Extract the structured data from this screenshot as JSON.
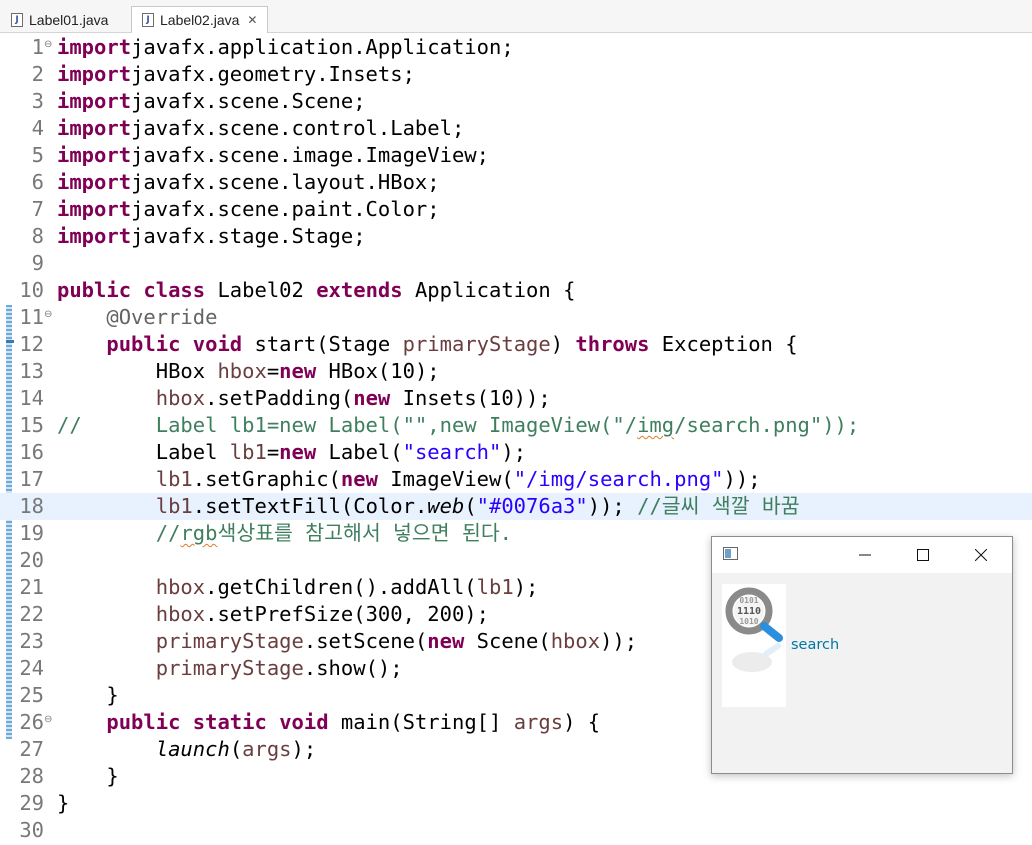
{
  "tabs": [
    {
      "label": "Label01.java",
      "icon": "java-file-icon",
      "active": false
    },
    {
      "label": "Label02.java",
      "icon": "java-file-icon",
      "active": true,
      "close_glyph": "✕"
    }
  ],
  "editor": {
    "current_line": 18,
    "lines": [
      {
        "n": "1",
        "fold": "⊖",
        "tokens": [
          [
            "kw",
            "import"
          ],
          [
            "",
            "javafx.application.Application;"
          ]
        ]
      },
      {
        "n": "2",
        "tokens": [
          [
            "kw",
            "import"
          ],
          [
            "",
            "javafx.geometry.Insets;"
          ]
        ]
      },
      {
        "n": "3",
        "tokens": [
          [
            "kw",
            "import"
          ],
          [
            "",
            "javafx.scene.Scene;"
          ]
        ]
      },
      {
        "n": "4",
        "tokens": [
          [
            "kw",
            "import"
          ],
          [
            "",
            "javafx.scene.control.Label;"
          ]
        ]
      },
      {
        "n": "5",
        "tokens": [
          [
            "kw",
            "import"
          ],
          [
            "",
            "javafx.scene.image.ImageView;"
          ]
        ]
      },
      {
        "n": "6",
        "tokens": [
          [
            "kw",
            "import"
          ],
          [
            "",
            "javafx.scene.layout.HBox;"
          ]
        ]
      },
      {
        "n": "7",
        "tokens": [
          [
            "kw",
            "import"
          ],
          [
            "",
            "javafx.scene.paint.Color;"
          ]
        ]
      },
      {
        "n": "8",
        "tokens": [
          [
            "kw",
            "import"
          ],
          [
            "",
            "javafx.stage.Stage;"
          ]
        ]
      },
      {
        "n": "9",
        "tokens": []
      },
      {
        "n": "10",
        "tokens": [
          [
            "kw",
            "public"
          ],
          [
            "",
            " "
          ],
          [
            "kw",
            "class"
          ],
          [
            "",
            " Label02 "
          ],
          [
            "kw",
            "extends"
          ],
          [
            "",
            " Application {"
          ]
        ]
      },
      {
        "n": "11",
        "fold": "⊖",
        "tokens": [
          [
            "",
            "    "
          ],
          [
            "ann",
            "@Override"
          ]
        ]
      },
      {
        "n": "12",
        "tokens": [
          [
            "",
            "    "
          ],
          [
            "kw",
            "public"
          ],
          [
            "",
            " "
          ],
          [
            "kw",
            "void"
          ],
          [
            "",
            " start(Stage "
          ],
          [
            "var",
            "primaryStage"
          ],
          [
            "",
            ") "
          ],
          [
            "kw",
            "throws"
          ],
          [
            "",
            " Exception {"
          ]
        ]
      },
      {
        "n": "13",
        "tokens": [
          [
            "",
            "        HBox "
          ],
          [
            "var",
            "hbox"
          ],
          [
            "",
            "="
          ],
          [
            "kw",
            "new"
          ],
          [
            "",
            " HBox(10);"
          ]
        ]
      },
      {
        "n": "14",
        "tokens": [
          [
            "",
            "        "
          ],
          [
            "var",
            "hbox"
          ],
          [
            "",
            ".setPadding("
          ],
          [
            "kw",
            "new"
          ],
          [
            "",
            " Insets(10));"
          ]
        ]
      },
      {
        "n": "15",
        "tokens": [
          [
            "cmt",
            "//      Label lb1=new Label(\"\",new ImageView(\"/"
          ],
          [
            "cmt spl",
            "img"
          ],
          [
            "cmt",
            "/search.png\"));"
          ]
        ]
      },
      {
        "n": "16",
        "tokens": [
          [
            "",
            "        Label "
          ],
          [
            "var",
            "lb1"
          ],
          [
            "",
            "="
          ],
          [
            "kw",
            "new"
          ],
          [
            "",
            " Label("
          ],
          [
            "str",
            "\"search\""
          ],
          [
            "",
            ");"
          ]
        ]
      },
      {
        "n": "17",
        "tokens": [
          [
            "",
            "        "
          ],
          [
            "var",
            "lb1"
          ],
          [
            "",
            ".setGraphic("
          ],
          [
            "kw",
            "new"
          ],
          [
            "",
            " ImageView("
          ],
          [
            "str",
            "\"/img/search.png\""
          ],
          [
            "",
            "));"
          ]
        ]
      },
      {
        "n": "18",
        "tokens": [
          [
            "",
            "        "
          ],
          [
            "var",
            "lb1"
          ],
          [
            "",
            ".setTextFill(Color."
          ],
          [
            "it",
            "web"
          ],
          [
            "",
            "("
          ],
          [
            "str",
            "\"#0076a3\""
          ],
          [
            "",
            "));"
          ],
          [
            "",
            " "
          ],
          [
            "cmt",
            "//글씨 색깔 바꿈"
          ]
        ]
      },
      {
        "n": "19",
        "tokens": [
          [
            "",
            "        "
          ],
          [
            "cmt",
            "//"
          ],
          [
            "cmt spl",
            "rgb"
          ],
          [
            "cmt",
            "색상표를 참고해서 넣으면 된다."
          ]
        ]
      },
      {
        "n": "20",
        "tokens": []
      },
      {
        "n": "21",
        "tokens": [
          [
            "",
            "        "
          ],
          [
            "var",
            "hbox"
          ],
          [
            "",
            ".getChildren().addAll("
          ],
          [
            "var",
            "lb1"
          ],
          [
            "",
            ");"
          ]
        ]
      },
      {
        "n": "22",
        "tokens": [
          [
            "",
            "        "
          ],
          [
            "var",
            "hbox"
          ],
          [
            "",
            ".setPrefSize(300, 200);"
          ]
        ]
      },
      {
        "n": "23",
        "tokens": [
          [
            "",
            "        "
          ],
          [
            "var",
            "primaryStage"
          ],
          [
            "",
            ".setScene("
          ],
          [
            "kw",
            "new"
          ],
          [
            "",
            " Scene("
          ],
          [
            "var",
            "hbox"
          ],
          [
            "",
            "));"
          ]
        ]
      },
      {
        "n": "24",
        "tokens": [
          [
            "",
            "        "
          ],
          [
            "var",
            "primaryStage"
          ],
          [
            "",
            ".show();"
          ]
        ]
      },
      {
        "n": "25",
        "tokens": [
          [
            "",
            "    }"
          ]
        ]
      },
      {
        "n": "26",
        "fold": "⊖",
        "tokens": [
          [
            "",
            "    "
          ],
          [
            "kw",
            "public"
          ],
          [
            "",
            " "
          ],
          [
            "kw",
            "static"
          ],
          [
            "",
            " "
          ],
          [
            "kw",
            "void"
          ],
          [
            "",
            " main(String[] "
          ],
          [
            "var",
            "args"
          ],
          [
            "",
            ") {"
          ]
        ]
      },
      {
        "n": "27",
        "tokens": [
          [
            "",
            "        "
          ],
          [
            "it",
            "launch"
          ],
          [
            "",
            "("
          ],
          [
            "var",
            "args"
          ],
          [
            "",
            ");"
          ]
        ]
      },
      {
        "n": "28",
        "tokens": [
          [
            "",
            "    }"
          ]
        ]
      },
      {
        "n": "29",
        "tokens": [
          [
            "",
            "}"
          ]
        ]
      },
      {
        "n": "30",
        "tokens": []
      }
    ]
  },
  "app_window": {
    "icon": "java-app-icon",
    "buttons": [
      "minimize-icon",
      "maximize-icon",
      "close-icon"
    ],
    "label_text": "search",
    "label_color": "#0076a3",
    "image_icon": "search-icon"
  },
  "colors": {
    "keyword": "#7f0055",
    "string": "#2a00ff",
    "comment": "#3f7f5f",
    "annotation": "#646464",
    "current_line": "#e8f2fe"
  }
}
